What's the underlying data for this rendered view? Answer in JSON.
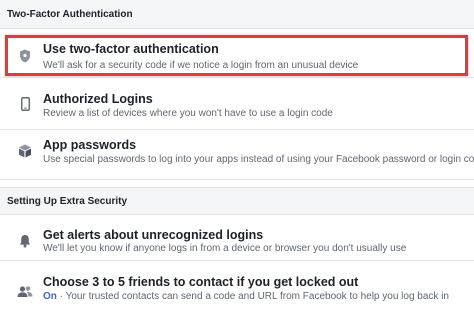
{
  "two_factor": {
    "header": "Two-Factor Authentication",
    "items": [
      {
        "icon": "shield-icon",
        "title": "Use two-factor authentication",
        "description": "We'll ask for a security code if we notice a login from an unusual device",
        "highlighted": true
      },
      {
        "icon": "phone-icon",
        "title": "Authorized Logins",
        "description": "Review a list of devices where you won't have to use a login code"
      },
      {
        "icon": "cube-icon",
        "title": "App passwords",
        "description": "Use special passwords to log into your apps instead of using your Facebook password or login codes"
      }
    ]
  },
  "extra_security": {
    "header": "Setting Up Extra Security",
    "items": [
      {
        "icon": "bell-icon",
        "title": "Get alerts about unrecognized logins",
        "description": "We'll let you know if anyone logs in from a device or browser you don't usually use"
      },
      {
        "icon": "friends-icon",
        "title": "Choose 3 to 5 friends to contact if you get locked out",
        "status": "On",
        "description": " · Your trusted contacts can send a code and URL from Facebook to help you log back in"
      }
    ]
  },
  "colors": {
    "highlight_border": "#e0393e",
    "header_bg": "#f5f6f7",
    "status_on": "#4267b2",
    "icon": "#606770"
  }
}
